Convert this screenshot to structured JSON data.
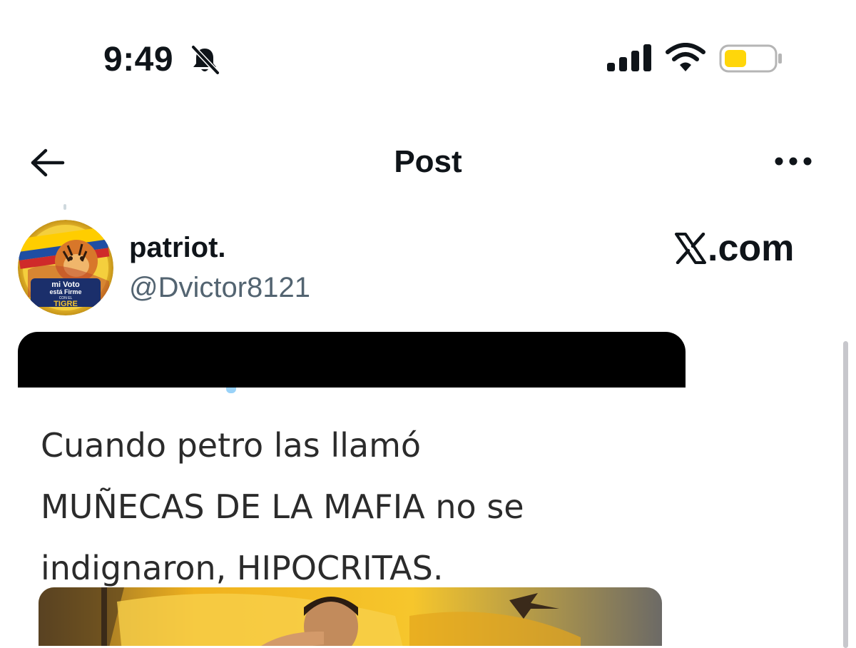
{
  "status_bar": {
    "time": "9:49",
    "icons": [
      "bell-slash-icon",
      "cellular-signal-icon",
      "wifi-icon",
      "battery-icon"
    ],
    "battery_color": "#ffd60a"
  },
  "header": {
    "title": "Post",
    "back_icon": "arrow-left-icon",
    "more_icon": "more-horizontal-icon"
  },
  "post": {
    "author": {
      "display_name": "patriot.",
      "handle": "@Dvictor8121",
      "avatar_text": {
        "line1": "mi Voto",
        "line2": "está Firme",
        "line3": "CON EL",
        "line4": "TIGRE"
      }
    },
    "watermark": ".com",
    "watermark_icon": "x-logo-icon",
    "media": {
      "text_lines": [
        "Cuando petro las llamó",
        "MUÑECAS DE LA MAFIA no se",
        "indignaron, HIPOCRITAS."
      ]
    }
  },
  "colors": {
    "text": "#0f1419",
    "secondary": "#536471",
    "accent": "#1d9bf0"
  }
}
